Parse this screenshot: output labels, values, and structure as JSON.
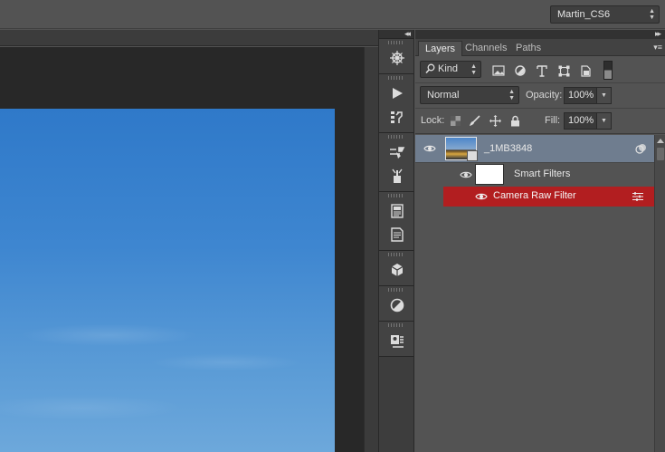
{
  "workspace": {
    "name": "Martin_CS6"
  },
  "panel": {
    "tabs": [
      {
        "label": "Layers",
        "active": true
      },
      {
        "label": "Channels",
        "active": false
      },
      {
        "label": "Paths",
        "active": false
      }
    ],
    "filter": {
      "kind_label": "Kind"
    },
    "blend": {
      "mode": "Normal",
      "opacity_label": "Opacity:",
      "opacity_value": "100%"
    },
    "lock": {
      "lock_label": "Lock:",
      "fill_label": "Fill:",
      "fill_value": "100%"
    },
    "layers": [
      {
        "name": "_1MB3848",
        "type": "smart-object",
        "visible": true,
        "selected": true
      },
      {
        "name": "Smart Filters",
        "type": "smart-filters",
        "visible": true
      },
      {
        "name": "Camera Raw Filter",
        "type": "filter",
        "visible": true,
        "highlight_color": "#b21e20"
      }
    ]
  },
  "dock": {
    "groups": [
      [
        "navigator-icon"
      ],
      [
        "actions-play-icon",
        "history-icon"
      ],
      [
        "brush-presets-icon",
        "clone-source-icon"
      ],
      [
        "paragraph-styles-icon",
        "character-styles-icon"
      ],
      [
        "3d-icon"
      ],
      [
        "adjustments-icon"
      ],
      [
        "properties-icon"
      ]
    ]
  },
  "colors": {
    "accent_selected_layer": "#6f7d8f",
    "filter_highlight": "#b21e20",
    "canvas_sky": "#3e86d0"
  }
}
